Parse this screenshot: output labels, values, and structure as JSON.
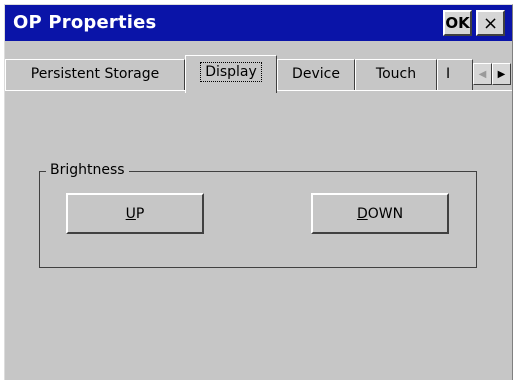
{
  "window": {
    "title": "OP Properties",
    "ok_label": "OK",
    "close_label": "×"
  },
  "tabs": [
    {
      "label": "Persistent Storage"
    },
    {
      "label": "Display",
      "active": true
    },
    {
      "label": "Device"
    },
    {
      "label": "Touch"
    },
    {
      "label": "I"
    }
  ],
  "tab_scroll": {
    "left_glyph": "◀",
    "right_glyph": "▶"
  },
  "brightness": {
    "legend": "Brightness",
    "up_accel": "U",
    "up_rest": "P",
    "down_accel": "D",
    "down_rest": "OWN"
  },
  "colors": {
    "titlebar": "#0a14a8",
    "face": "#c6c6c6"
  }
}
